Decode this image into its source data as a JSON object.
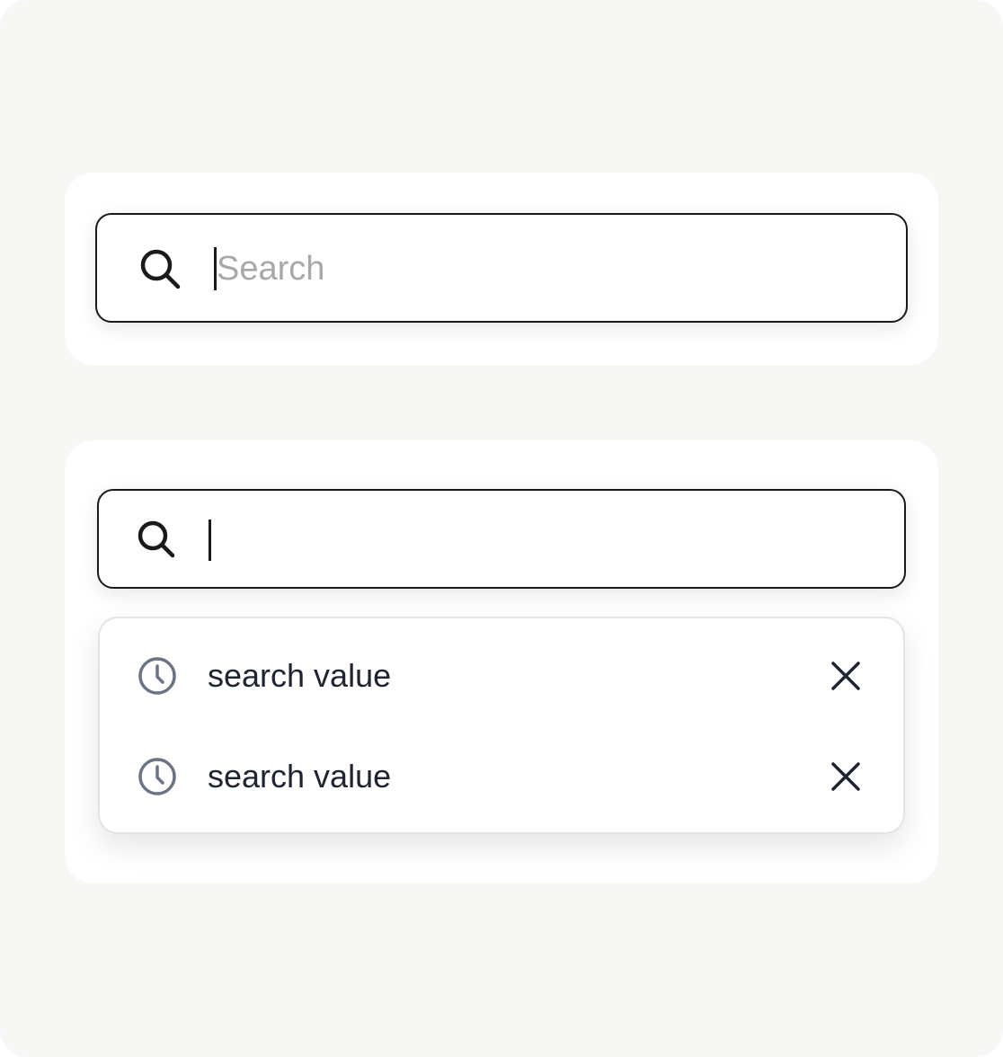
{
  "search_empty": {
    "placeholder": "Search",
    "value": ""
  },
  "search_with_history": {
    "placeholder": "",
    "value": "",
    "history": [
      {
        "label": "search value",
        "icon": "clock-icon",
        "remove_icon": "close-icon"
      },
      {
        "label": "search value",
        "icon": "clock-icon",
        "remove_icon": "close-icon"
      }
    ]
  },
  "colors": {
    "background": "#f7f7f6",
    "card": "#ffffff",
    "border": "#1a1a1a",
    "placeholder": "#a8a8a8",
    "history_icon": "#6b7385",
    "text": "#1f2430"
  }
}
